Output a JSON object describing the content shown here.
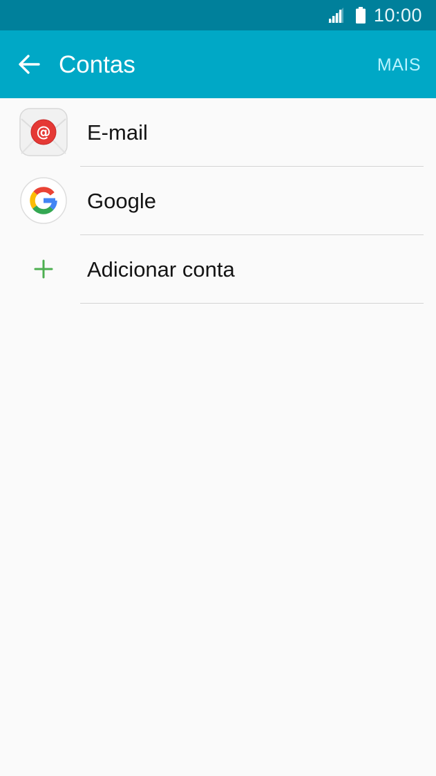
{
  "status_bar": {
    "time": "10:00",
    "icons": [
      "signal-icon",
      "battery-icon"
    ]
  },
  "app_bar": {
    "title": "Contas",
    "back_icon": "back-arrow-icon",
    "more_label": "MAIS"
  },
  "accounts": [
    {
      "label": "E-mail",
      "icon": "email-app-icon"
    },
    {
      "label": "Google",
      "icon": "google-icon"
    },
    {
      "label": "Adicionar conta",
      "icon": "plus-icon"
    }
  ],
  "colors": {
    "status_bar": "#00809b",
    "app_bar": "#00a8c6",
    "accent_light": "#b8f3ff",
    "plus_green": "#4caf50",
    "background": "#fafafa"
  }
}
